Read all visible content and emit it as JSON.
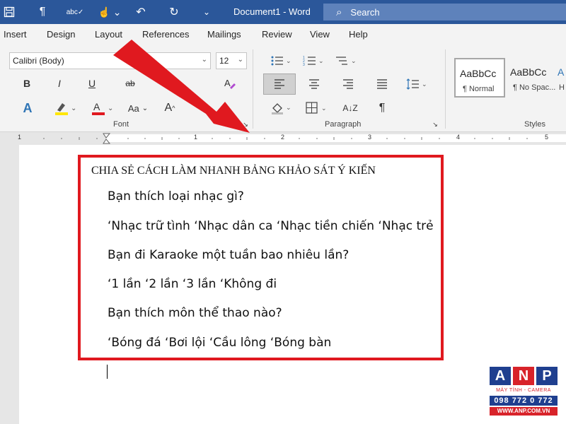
{
  "titlebar": {
    "doc_title": "Document1  -  Word",
    "search_label": "Search",
    "icons": [
      "save-icon",
      "paragraph-mark-icon",
      "spelling-icon",
      "touch-mode-icon",
      "undo-icon",
      "redo-icon",
      "customize-icon"
    ]
  },
  "tabs": [
    "Insert",
    "Design",
    "Layout",
    "References",
    "Mailings",
    "Review",
    "View",
    "Help"
  ],
  "ribbon": {
    "font_name": "Calibri (Body)",
    "font_size": "12",
    "font_group_label": "Font",
    "paragraph_group_label": "Paragraph",
    "styles_group_label": "Styles",
    "bold": "B",
    "italic": "I",
    "underline": "U",
    "strike": "ab",
    "font_color": "A",
    "change_case": "Aa",
    "text_effects": "A",
    "styles": [
      {
        "sample": "AaBbCc",
        "name": "¶ Normal"
      },
      {
        "sample": "AaBbCc",
        "name": "¶ No Spac..."
      },
      {
        "sample": "A",
        "name": "H"
      }
    ]
  },
  "ruler": {
    "numbers": [
      "1",
      "1",
      "2",
      "3",
      "4",
      "5"
    ]
  },
  "document": {
    "heading": "CHIA SẺ CÁCH LÀM NHANH BẢNG KHẢO SÁT Ý KIẾN",
    "lines": [
      "Bạn thích loại nhạc gì?",
      "‘Nhạc trữ tình ‘Nhạc dân ca ‘Nhạc tiền chiến ‘Nhạc trẻ",
      "Bạn đi Karaoke một tuần bao nhiêu lần?",
      "‘1 lần ‘2 lần ‘3 lần ‘Không đi",
      "Bạn thích môn thể thao nào?",
      "‘Bóng đá ‘Bơi lội ‘Cầu lông ‘Bóng bàn"
    ]
  },
  "logo": {
    "letters": [
      "A",
      "N",
      "P"
    ],
    "tagline": "MÁY TÍNH - CAMERA",
    "phone": "098 772 0 772",
    "website": "WWW.ANP.COM.VN"
  },
  "colors": {
    "title_bar": "#2b579a",
    "highlight_frame": "#e0191f",
    "arrow": "#e0191f",
    "logo_blue": "#1f3f8f",
    "logo_red": "#d8232a"
  }
}
